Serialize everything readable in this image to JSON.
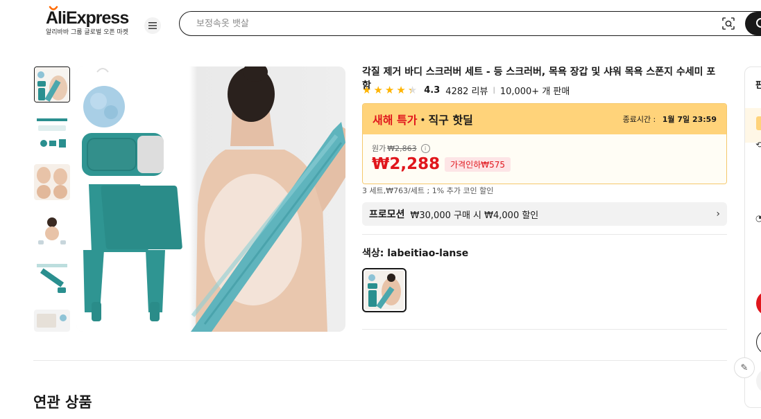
{
  "header": {
    "logo_text": "AliExpress",
    "logo_sub": "알리바바 그룹 글로벌 오픈 마켓",
    "search_placeholder": "보정속옷 뱃살"
  },
  "product": {
    "title": "각질 제거 바디 스크러버 세트 - 등 스크러버, 목욕 장갑 및 샤워 목욕 스폰지 수세미 포함",
    "rating": "4.3",
    "reviews": "4282 리뷰",
    "sold": "10,000+ 개 판매",
    "deal": {
      "label_red": "새해 특가",
      "label_dark": "・직구 핫딜",
      "end_label": "종료시간 :",
      "end_time": "1월 7일 23:59",
      "original_label": "원가",
      "original_price": "₩2,863",
      "price": "₩2,288",
      "discount": "가격인하₩575"
    },
    "coin_note": "3 세트,₩763/세트 ; 1% 추가 코인 할인",
    "promo": {
      "tag": "프로모션",
      "text": "₩30,000 구매 시 ₩4,000 할인"
    },
    "color_label": "색상: labeitiao-lanse"
  },
  "related_title": "연관 상품",
  "side_panel": {
    "title": "판"
  },
  "colors": {
    "accent_red": "#e0161c",
    "deal_yellow": "#ffd37a",
    "teal": "#2a8f8f"
  }
}
